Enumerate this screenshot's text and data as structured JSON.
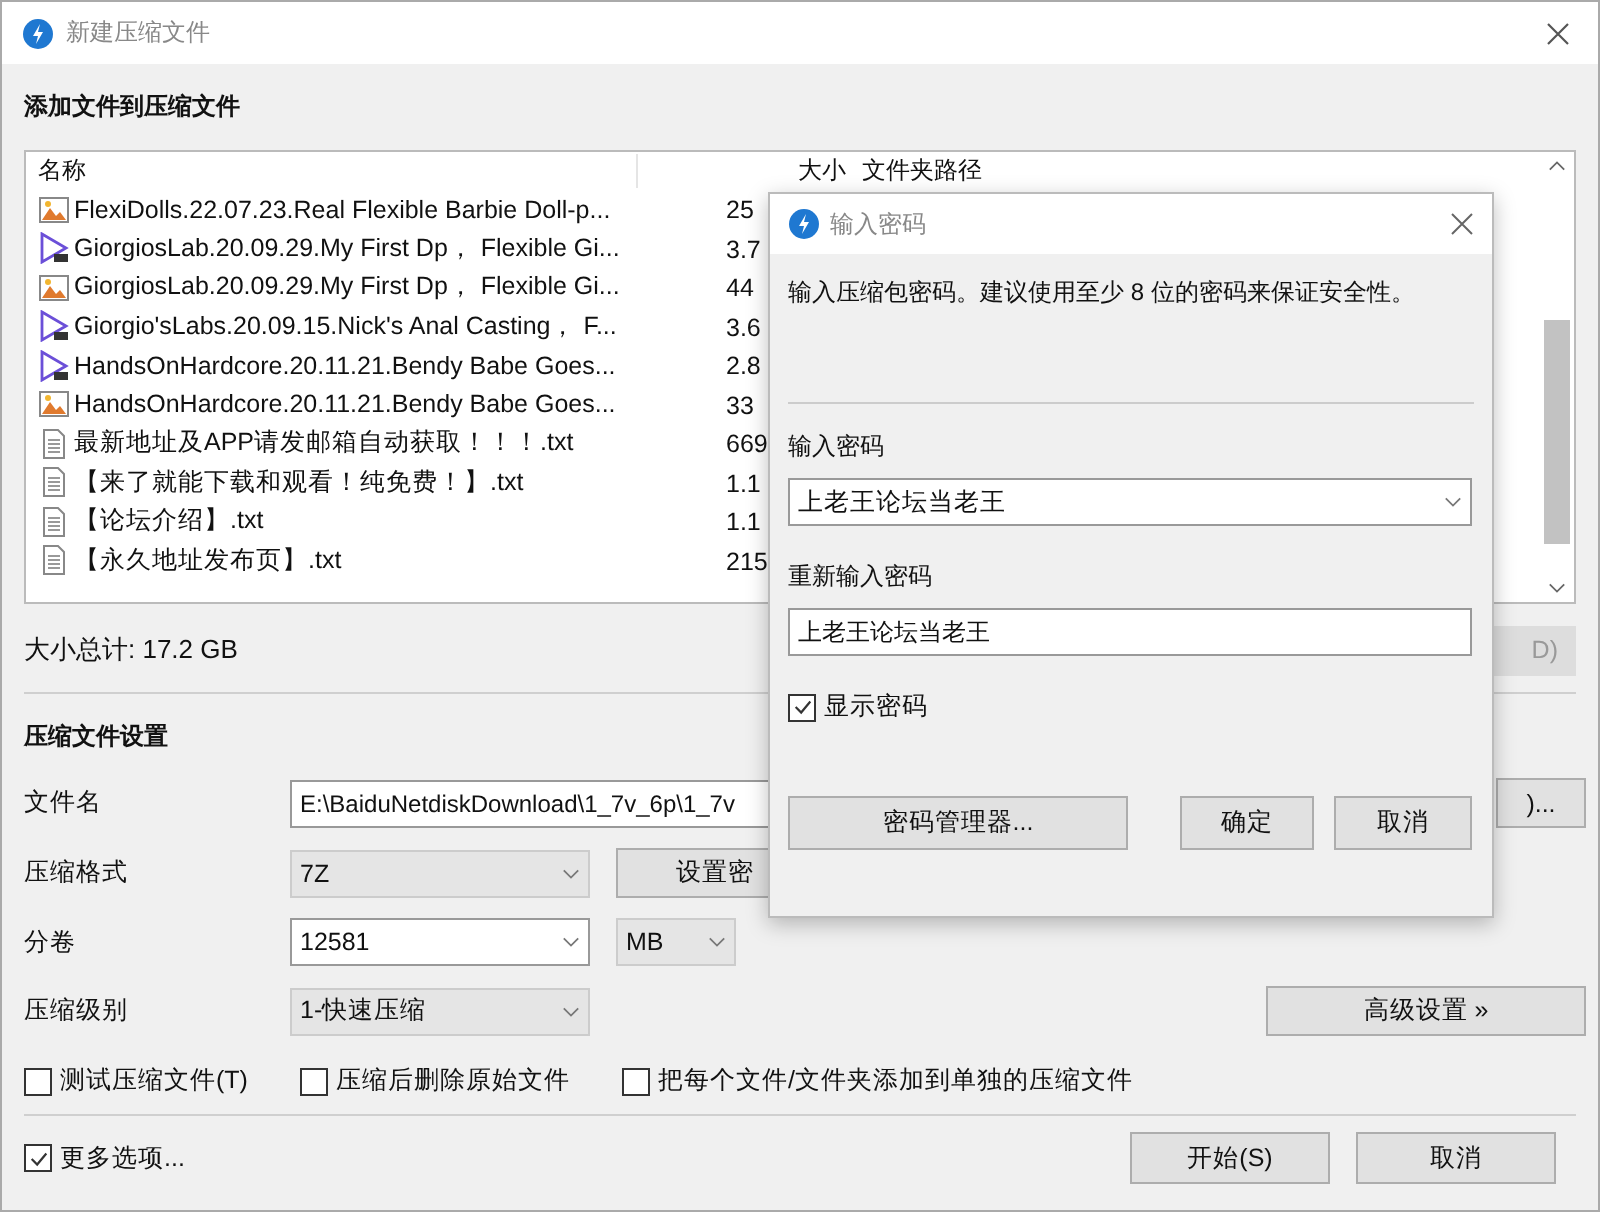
{
  "window": {
    "title": "新建压缩文件"
  },
  "files": {
    "heading": "添加文件到压缩文件",
    "columns": [
      "名称",
      "大小",
      "文件夹路径"
    ],
    "rows": [
      {
        "kind": "image",
        "name": "FlexiDolls.22.07.23.Real Flexible Barbie Doll-p...",
        "size": "25"
      },
      {
        "kind": "video",
        "name": "GiorgiosLab.20.09.29.My First Dp， Flexible Gi...",
        "size": "3.7"
      },
      {
        "kind": "image",
        "name": "GiorgiosLab.20.09.29.My First Dp， Flexible Gi...",
        "size": "44"
      },
      {
        "kind": "video",
        "name": "Giorgio'sLabs.20.09.15.Nick's Anal Casting， F...",
        "size": "3.6"
      },
      {
        "kind": "video",
        "name": "HandsOnHardcore.20.11.21.Bendy Babe Goes...",
        "size": "2.8"
      },
      {
        "kind": "image",
        "name": "HandsOnHardcore.20.11.21.Bendy Babe Goes...",
        "size": "33"
      },
      {
        "kind": "text",
        "name": "最新地址及APP请发邮箱自动获取！！！.txt",
        "size": "669"
      },
      {
        "kind": "text",
        "name": "【来了就能下载和观看！纯免费！】.txt",
        "size": "1.1"
      },
      {
        "kind": "text",
        "name": "【论坛介绍】.txt",
        "size": "1.1"
      },
      {
        "kind": "text",
        "name": "【永久地址发布页】.txt",
        "size": "215"
      }
    ],
    "total": "大小总计: 17.2 GB",
    "remove_button": "D)"
  },
  "settings": {
    "heading": "压缩文件设置",
    "filename": {
      "label": "文件名",
      "value": "E:\\BaiduNetdiskDownload\\1_7v_6p\\1_7v",
      "browse_button": ")..."
    },
    "format": {
      "label": "压缩格式",
      "value": "7Z",
      "password_button": "设置密"
    },
    "split": {
      "label": "分卷",
      "value": "12581",
      "unit": "MB"
    },
    "level": {
      "label": "压缩级别",
      "value": "1-快速压缩"
    },
    "advanced_button": "高级设置 »",
    "options": [
      {
        "label": "测试压缩文件(T)",
        "checked": false
      },
      {
        "label": "压缩后删除原始文件",
        "checked": false
      },
      {
        "label": "把每个文件/文件夹添加到单独的压缩文件",
        "checked": false
      }
    ]
  },
  "more_options": {
    "label": "更多选项...",
    "checked": true
  },
  "buttons": [
    "开始(S)",
    "取消"
  ],
  "dialog": {
    "title": "输入密码",
    "message": "输入压缩包密码。建议使用至少 8 位的密码来保证安全性。",
    "password_label": "输入密码",
    "password": "上老王论坛当老王",
    "confirm_label": "重新输入密码",
    "confirm": "上老王论坛当老王",
    "show_password": {
      "label": "显示密码",
      "checked": true
    },
    "buttons": [
      "密码管理器...",
      "确定",
      "取消"
    ]
  }
}
